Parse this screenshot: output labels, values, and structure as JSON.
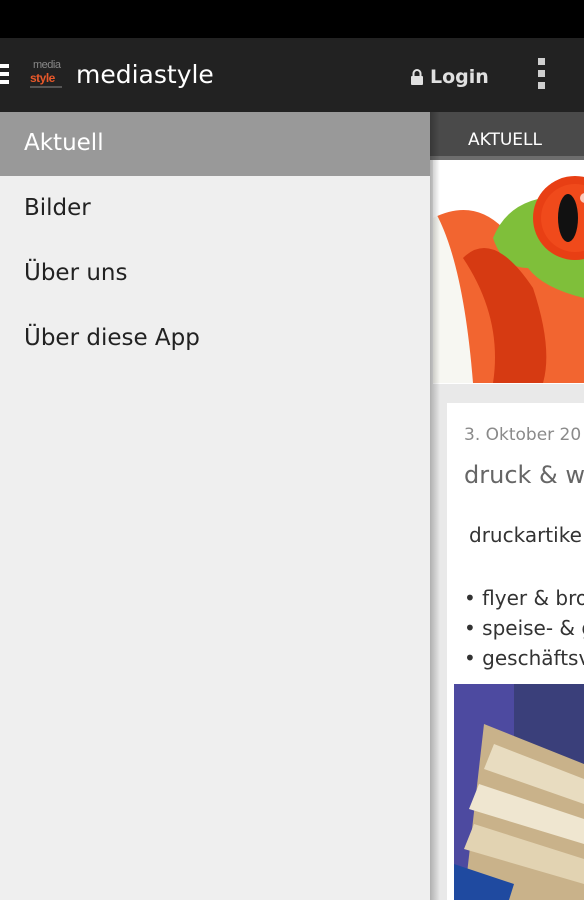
{
  "app": {
    "title": "mediastyle",
    "logo_top": "media",
    "logo_bottom": "style"
  },
  "actionbar": {
    "login_label": "Login"
  },
  "drawer": {
    "items": [
      {
        "label": "Aktuell",
        "active": true
      },
      {
        "label": "Bilder"
      },
      {
        "label": "Über uns"
      },
      {
        "label": "Über diese App"
      }
    ]
  },
  "tabs": {
    "current": "AKTUELL"
  },
  "post": {
    "date": "3. Oktober 20",
    "title": "druck & we",
    "intro": "druckartike",
    "bullets": [
      "• flyer & bros",
      "• speise- & g",
      "• geschäftsv"
    ]
  },
  "colors": {
    "actionbar": "#222222",
    "drawer_active": "#999999",
    "logo_accent": "#e8582a"
  }
}
